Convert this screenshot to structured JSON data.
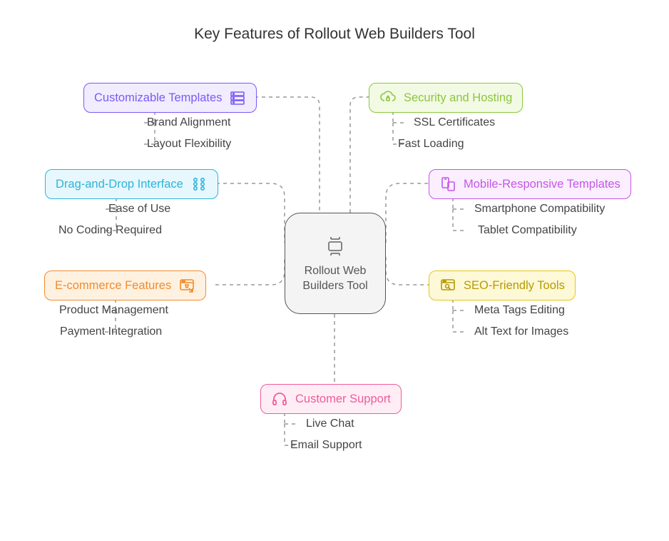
{
  "title": "Key Features of Rollout Web Builders Tool",
  "center": {
    "label_line1": "Rollout Web",
    "label_line2": "Builders Tool"
  },
  "features": {
    "templates": {
      "label": "Customizable Templates",
      "color": "#7a5af5",
      "bg": "#f1edff",
      "sub1": "Brand Alignment",
      "sub2": "Layout Flexibility"
    },
    "dragdrop": {
      "label": "Drag-and-Drop Interface",
      "color": "#2db3db",
      "bg": "#e6f8fd",
      "sub1": "Ease of Use",
      "sub2": "No Coding Required"
    },
    "ecommerce": {
      "label": "E-commerce Features",
      "color": "#f08c2e",
      "bg": "#fff1e0",
      "sub1": "Product Management",
      "sub2": "Payment Integration"
    },
    "security": {
      "label": "Security and Hosting",
      "color": "#8dc63f",
      "bg": "#f2fae4",
      "sub1": "SSL Certificates",
      "sub2": "Fast Loading"
    },
    "mobile": {
      "label": "Mobile-Responsive Templates",
      "color": "#c457e6",
      "bg": "#faeeff",
      "sub1": "Smartphone Compatibility",
      "sub2": "Tablet Compatibility"
    },
    "seo": {
      "label": "SEO-Friendly Tools",
      "color": "#e6c817",
      "bg": "#fdf8d6",
      "sub1": "Meta Tags Editing",
      "sub2": "Alt Text for Images"
    },
    "support": {
      "label": "Customer Support",
      "color": "#ed5d9a",
      "bg": "#ffedf5",
      "sub1": "Live Chat",
      "sub2": "Email Support"
    }
  }
}
